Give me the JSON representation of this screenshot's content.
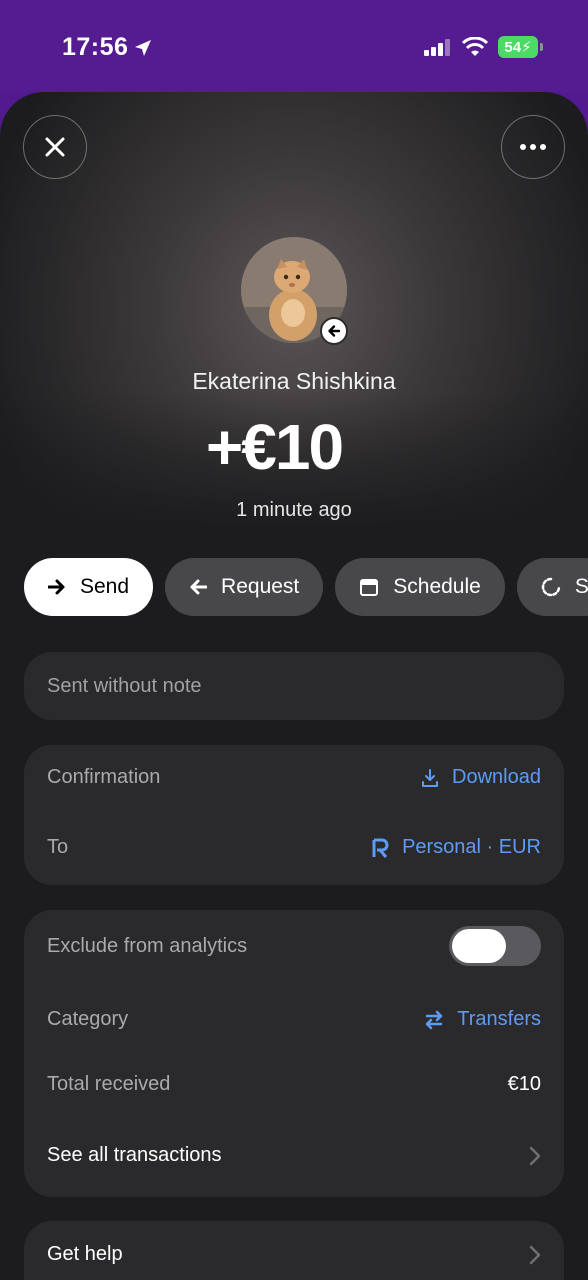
{
  "status_bar": {
    "time": "17:56",
    "battery": "54"
  },
  "contact": {
    "name": "Ekaterina Shishkina"
  },
  "transaction": {
    "amount": "+€10",
    "time_ago": "1 minute ago"
  },
  "actions": [
    {
      "label": "Send",
      "icon": "arrow-right-icon"
    },
    {
      "label": "Request",
      "icon": "arrow-left-icon"
    },
    {
      "label": "Schedule",
      "icon": "calendar-icon"
    },
    {
      "label": "S",
      "icon": "loading-circle-icon"
    }
  ],
  "note": {
    "text": "Sent without note"
  },
  "details": {
    "confirmation_label": "Confirmation",
    "download_label": "Download",
    "to_label": "To",
    "to_value": "Personal · EUR"
  },
  "analytics": {
    "exclude_label": "Exclude from analytics",
    "exclude_enabled": false,
    "category_label": "Category",
    "category_value": "Transfers",
    "total_label": "Total received",
    "total_value": "€10",
    "see_all_label": "See all transactions"
  },
  "help": {
    "label": "Get help"
  },
  "colors": {
    "accent": "#5e9bf5",
    "status_bar": "#551c91",
    "card": "#2a2a2c",
    "sheet": "#1c1c1e"
  }
}
